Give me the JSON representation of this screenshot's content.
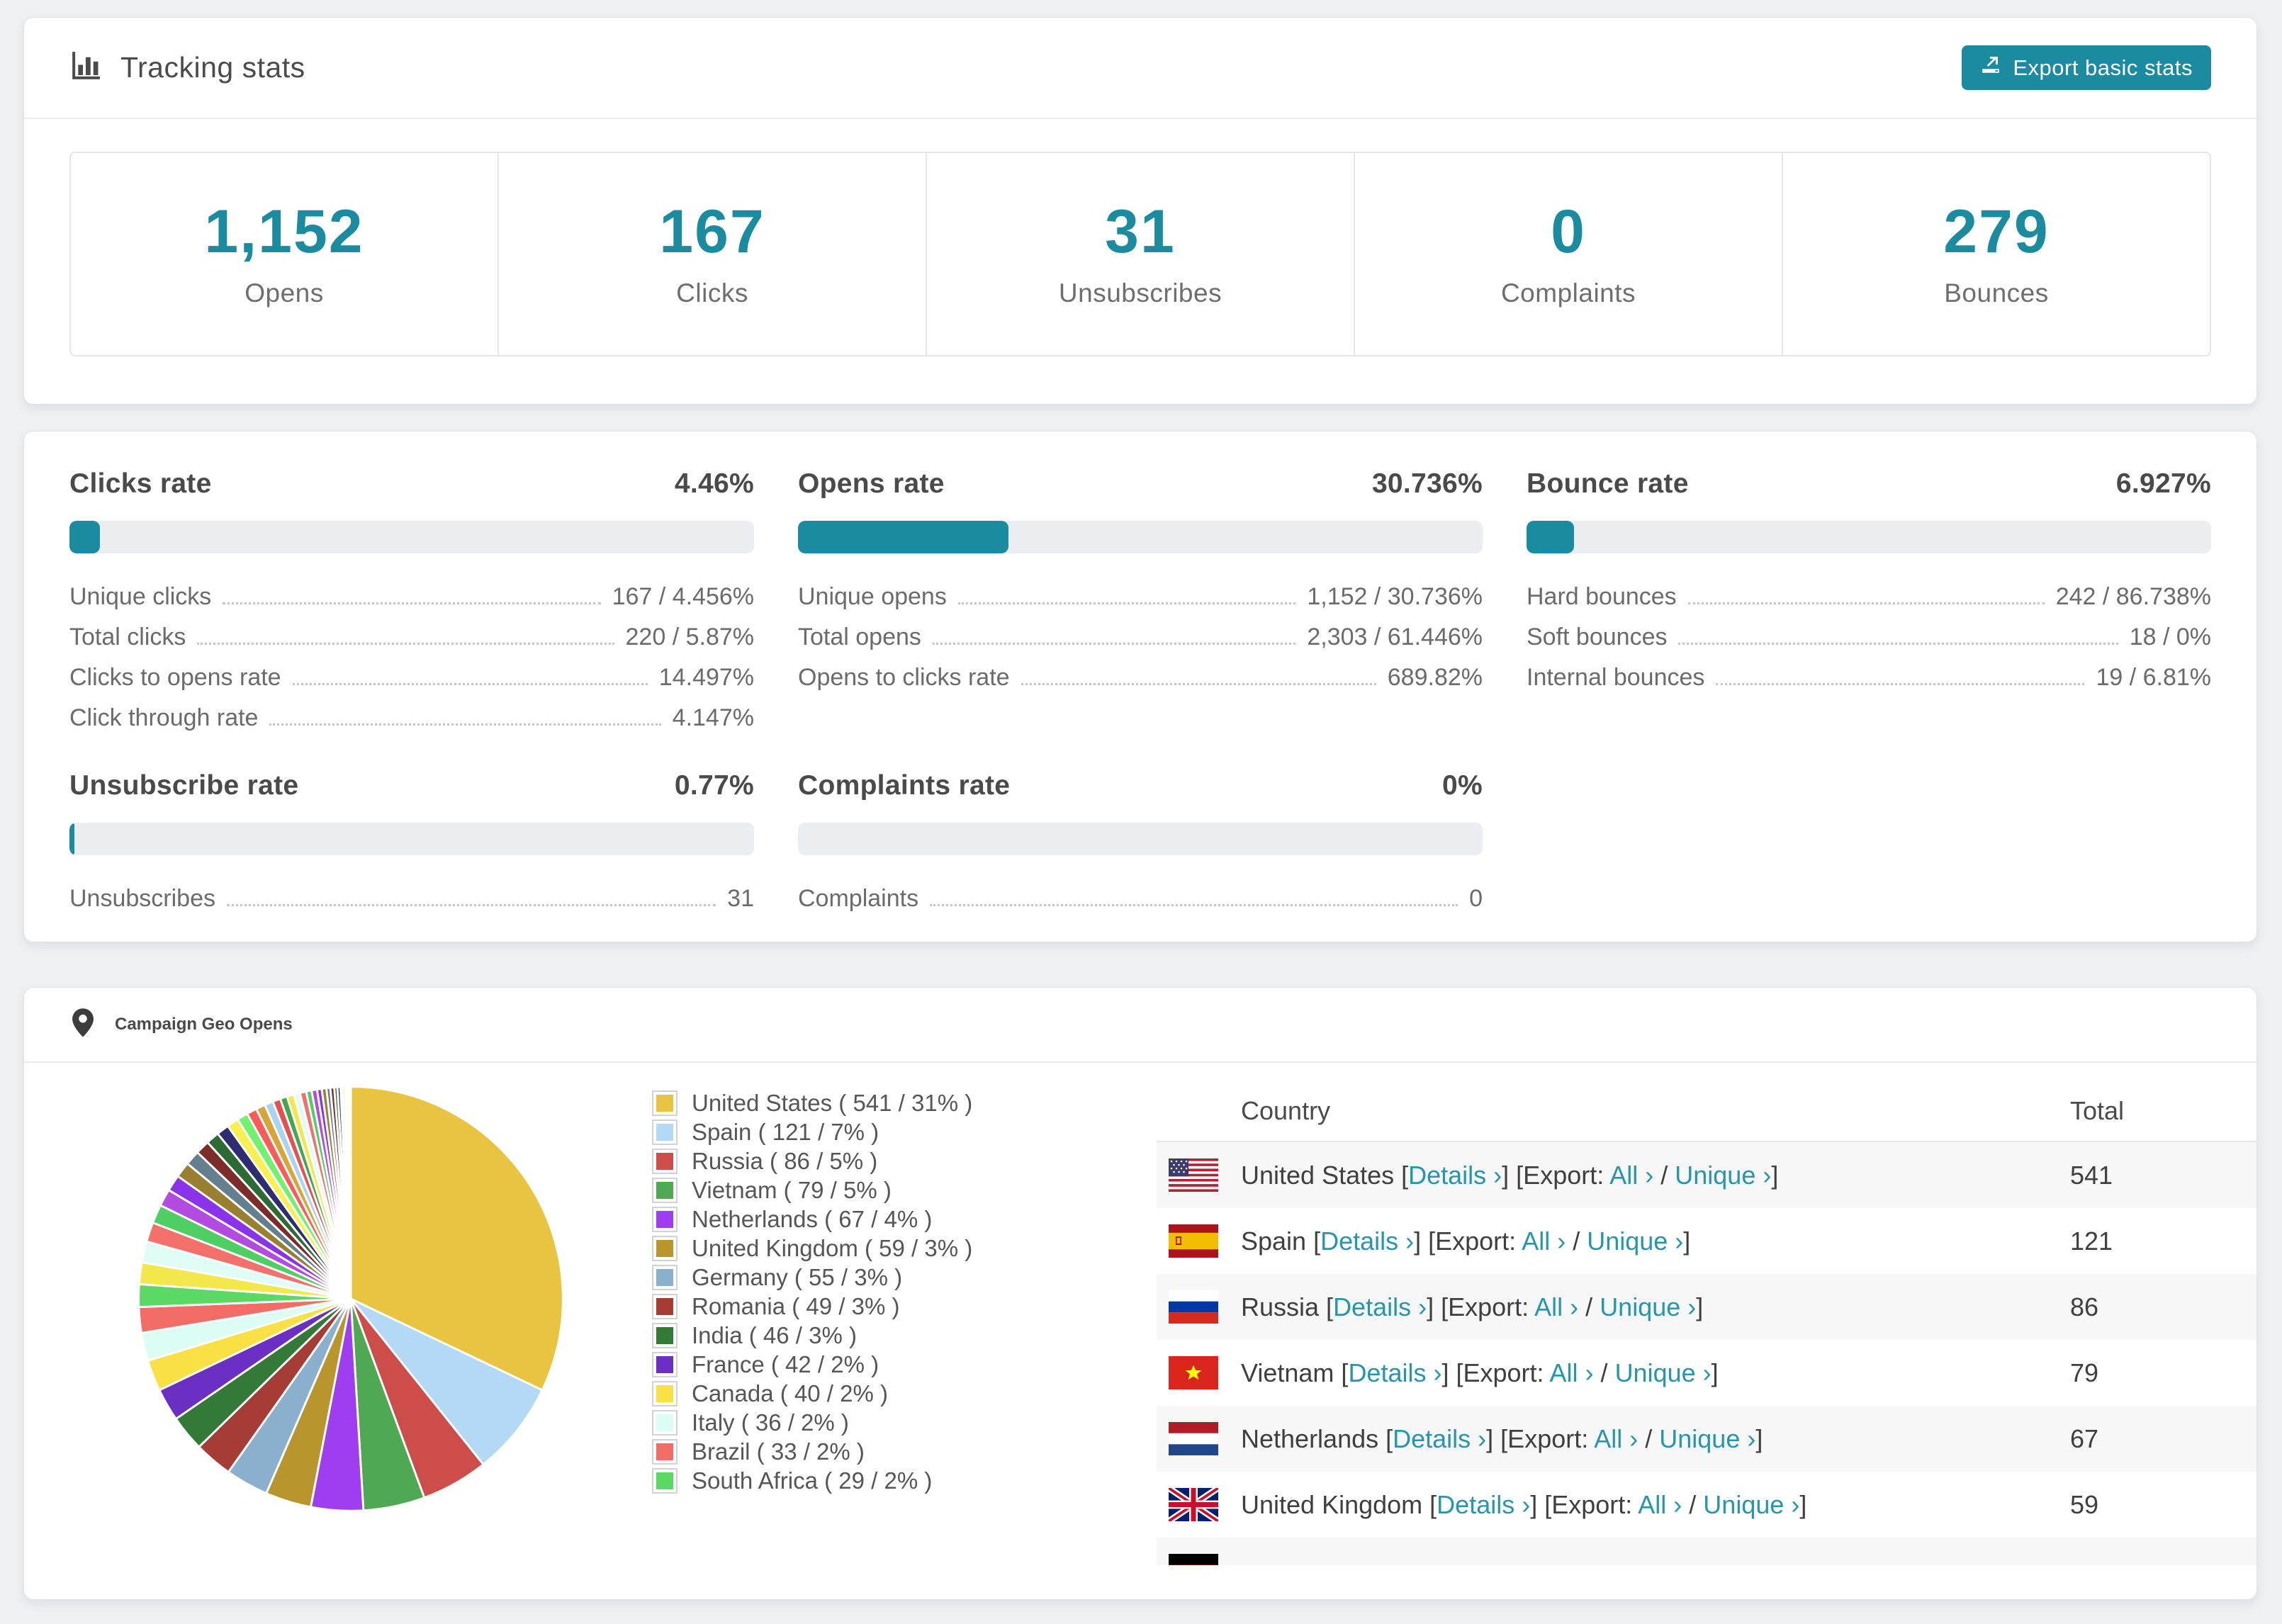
{
  "tracking": {
    "title": "Tracking stats",
    "export_button_label": "Export basic stats",
    "stats": [
      {
        "value": "1,152",
        "label": "Opens"
      },
      {
        "value": "167",
        "label": "Clicks"
      },
      {
        "value": "31",
        "label": "Unsubscribes"
      },
      {
        "value": "0",
        "label": "Complaints"
      },
      {
        "value": "279",
        "label": "Bounces"
      }
    ]
  },
  "rates": {
    "clicks": {
      "title": "Clicks rate",
      "value": "4.46%",
      "pct": 4.46,
      "rows": [
        {
          "label": "Unique clicks",
          "value": "167 / 4.456%"
        },
        {
          "label": "Total clicks",
          "value": "220 / 5.87%"
        },
        {
          "label": "Clicks to opens rate",
          "value": "14.497%"
        },
        {
          "label": "Click through rate",
          "value": "4.147%"
        }
      ]
    },
    "opens": {
      "title": "Opens rate",
      "value": "30.736%",
      "pct": 30.736,
      "rows": [
        {
          "label": "Unique opens",
          "value": "1,152 / 30.736%"
        },
        {
          "label": "Total opens",
          "value": "2,303 / 61.446%"
        },
        {
          "label": "Opens to clicks rate",
          "value": "689.82%"
        }
      ]
    },
    "bounce": {
      "title": "Bounce rate",
      "value": "6.927%",
      "pct": 6.927,
      "rows": [
        {
          "label": "Hard bounces",
          "value": "242 / 86.738%"
        },
        {
          "label": "Soft bounces",
          "value": "18 / 0%"
        },
        {
          "label": "Internal bounces",
          "value": "19 / 6.81%"
        }
      ]
    },
    "unsubscribe": {
      "title": "Unsubscribe rate",
      "value": "0.77%",
      "pct": 0.77,
      "rows": [
        {
          "label": "Unsubscribes",
          "value": "31"
        }
      ]
    },
    "complaints": {
      "title": "Complaints rate",
      "value": "0%",
      "pct": 0,
      "rows": [
        {
          "label": "Complaints",
          "value": "0"
        }
      ]
    }
  },
  "geo": {
    "title": "Campaign Geo Opens",
    "table": {
      "header": {
        "country": "Country",
        "total": "Total"
      },
      "links": {
        "lb": " [",
        "details": "Details ›",
        "export": "] [Export: ",
        "all": "All ›",
        "slash": " / ",
        "unique": "Unique ›",
        "rb": "]"
      },
      "rows": [
        {
          "name": "United States",
          "total": "541",
          "flag": "us"
        },
        {
          "name": "Spain",
          "total": "121",
          "flag": "es"
        },
        {
          "name": "Russia",
          "total": "86",
          "flag": "ru"
        },
        {
          "name": "Vietnam",
          "total": "79",
          "flag": "vn"
        },
        {
          "name": "Netherlands",
          "total": "67",
          "flag": "nl"
        },
        {
          "name": "United Kingdom",
          "total": "59",
          "flag": "gb"
        },
        {
          "name": "",
          "total": "",
          "flag": "de"
        }
      ]
    }
  },
  "chart_data": {
    "type": "pie",
    "title": "Campaign Geo Opens",
    "legend_position": "right",
    "slices": [
      {
        "name": "United States",
        "value": 541,
        "pct": "31%",
        "color": "#e9c440",
        "legend_label": "United States ( 541 / 31% )"
      },
      {
        "name": "Spain",
        "value": 121,
        "pct": "7%",
        "color": "#b3d9f5",
        "legend_label": "Spain ( 121 / 7% )"
      },
      {
        "name": "Russia",
        "value": 86,
        "pct": "5%",
        "color": "#cc4d49",
        "legend_label": "Russia ( 86 / 5% )"
      },
      {
        "name": "Vietnam",
        "value": 79,
        "pct": "5%",
        "color": "#4ea952",
        "legend_label": "Vietnam ( 79 / 5% )"
      },
      {
        "name": "Netherlands",
        "value": 67,
        "pct": "4%",
        "color": "#9e3ef0",
        "legend_label": "Netherlands ( 67 / 4% )"
      },
      {
        "name": "United Kingdom",
        "value": 59,
        "pct": "3%",
        "color": "#b9952e",
        "legend_label": "United Kingdom ( 59 / 3% )"
      },
      {
        "name": "Germany",
        "value": 55,
        "pct": "3%",
        "color": "#8bb0ce",
        "legend_label": "Germany ( 55 / 3% )"
      },
      {
        "name": "Romania",
        "value": 49,
        "pct": "3%",
        "color": "#a53d36",
        "legend_label": "Romania ( 49 / 3% )"
      },
      {
        "name": "India",
        "value": 46,
        "pct": "3%",
        "color": "#337a38",
        "legend_label": "India ( 46 / 3% )"
      },
      {
        "name": "France",
        "value": 42,
        "pct": "2%",
        "color": "#6b2fc4",
        "legend_label": "France ( 42 / 2% )"
      },
      {
        "name": "Canada",
        "value": 40,
        "pct": "2%",
        "color": "#f9e045",
        "legend_label": "Canada ( 40 / 2% )"
      },
      {
        "name": "Italy",
        "value": 36,
        "pct": "2%",
        "color": "#dcfdf4",
        "legend_label": "Italy ( 36 / 2% )"
      },
      {
        "name": "Brazil",
        "value": 33,
        "pct": "2%",
        "color": "#f36c66",
        "legend_label": "Brazil ( 33 / 2% )"
      },
      {
        "name": "South Africa",
        "value": 29,
        "pct": "2%",
        "color": "#5bd964",
        "legend_label": "South Africa ( 29 / 2% )"
      }
    ],
    "others_tail": {
      "values": [
        28,
        27,
        25,
        24,
        22,
        21,
        20,
        19,
        18,
        17,
        16,
        15,
        14,
        13,
        12,
        11,
        10,
        9,
        9,
        8,
        8,
        7,
        7,
        6,
        6,
        5,
        5,
        4,
        4,
        3,
        3,
        2,
        2,
        1,
        1,
        1
      ],
      "palette": [
        "#f2e74b",
        "#dffcf7",
        "#f4716b",
        "#4fcf63",
        "#b44be0",
        "#8a33ea",
        "#998030",
        "#64808f",
        "#7c2d2a",
        "#2c6b34",
        "#2e2d72",
        "#f6f14f",
        "#6ff26f",
        "#fa5c5c",
        "#d8a636",
        "#a8d4f2",
        "#e65050",
        "#41a84f"
      ]
    }
  },
  "theme": {
    "accent": "#1b8ba0",
    "link": "#2596ab",
    "bar_track": "#ebedf1",
    "page_bg": "#eef0f4",
    "row_shade": "#f7f7f7"
  }
}
